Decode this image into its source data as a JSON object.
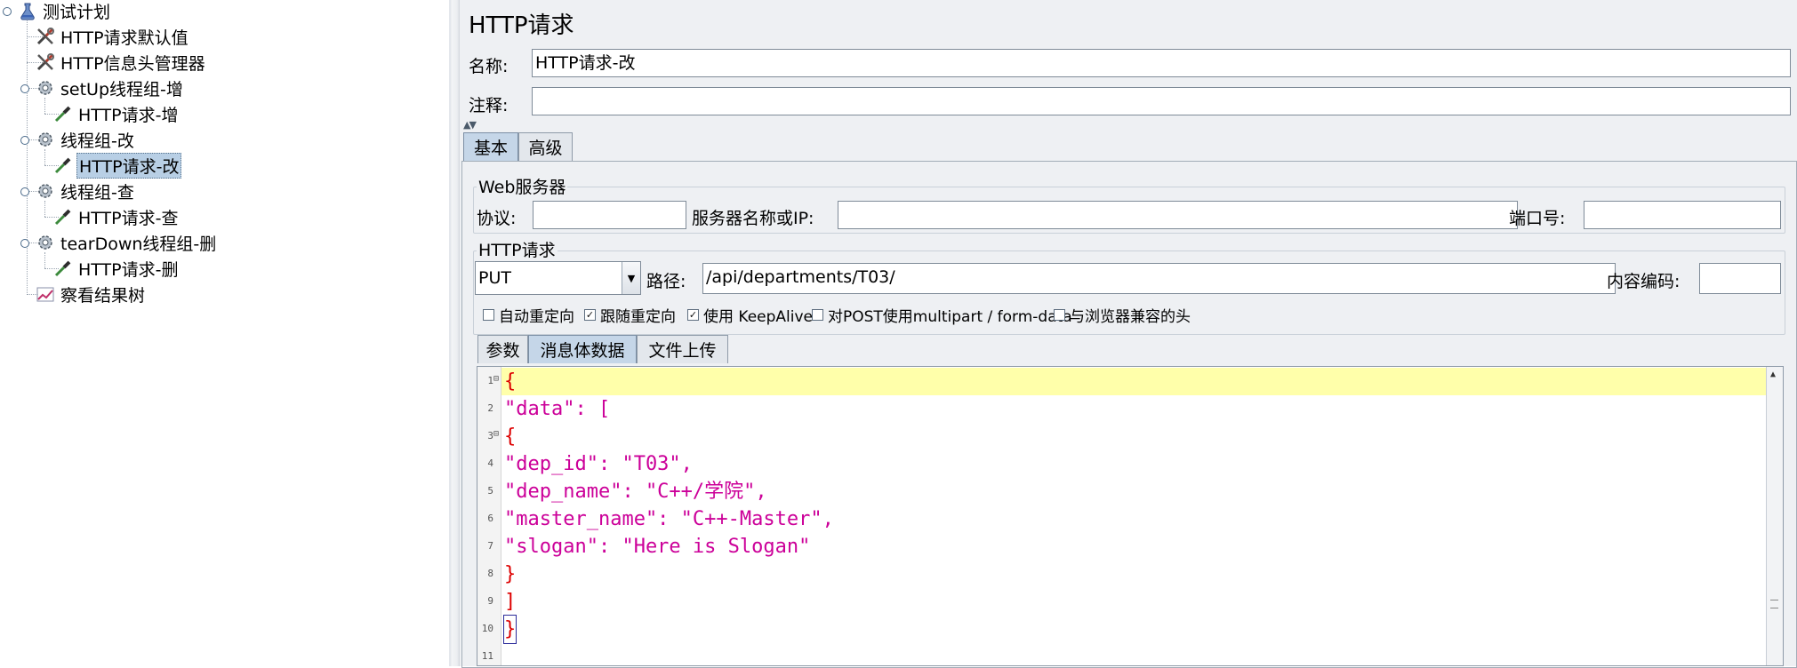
{
  "tree": {
    "items": [
      {
        "label": "测试计划",
        "icon": "flask-icon"
      },
      {
        "label": "HTTP请求默认值",
        "icon": "wrench-icon"
      },
      {
        "label": "HTTP信息头管理器",
        "icon": "wrench-icon"
      },
      {
        "label": "setUp线程组-增",
        "icon": "gear-icon"
      },
      {
        "label": "HTTP请求-增",
        "icon": "pipette-icon"
      },
      {
        "label": "线程组-改",
        "icon": "gear-icon"
      },
      {
        "label": "HTTP请求-改",
        "icon": "pipette-icon",
        "selected": true
      },
      {
        "label": "线程组-查",
        "icon": "gear-icon"
      },
      {
        "label": "HTTP请求-查",
        "icon": "pipette-icon"
      },
      {
        "label": "tearDown线程组-删",
        "icon": "gear-icon"
      },
      {
        "label": "HTTP请求-删",
        "icon": "pipette-icon"
      },
      {
        "label": "察看结果树",
        "icon": "graph-icon"
      }
    ]
  },
  "panel": {
    "title": "HTTP请求",
    "name_label": "名称:",
    "name_value": "HTTP请求-改",
    "comment_label": "注释:",
    "comment_value": "",
    "tabs": [
      "基本",
      "高级"
    ],
    "active_tab": "基本",
    "web_server": {
      "group_title": "Web服务器",
      "protocol_label": "协议:",
      "protocol_value": "",
      "server_label": "服务器名称或IP:",
      "server_value": "",
      "port_label": "端口号:",
      "port_value": ""
    },
    "http_request": {
      "group_title": "HTTP请求",
      "method": "PUT",
      "path_label": "路径:",
      "path_value": "/api/departments/T03/",
      "encoding_label": "内容编码:",
      "encoding_value": ""
    },
    "checkboxes": [
      {
        "label": "自动重定向",
        "checked": false
      },
      {
        "label": "跟随重定向",
        "checked": true
      },
      {
        "label": "使用 KeepAlive",
        "checked": true
      },
      {
        "label": "对POST使用multipart / form-data",
        "checked": false
      },
      {
        "label": "与浏览器兼容的头",
        "checked": false
      }
    ],
    "sub_tabs": [
      "参数",
      "消息体数据",
      "文件上传"
    ],
    "active_sub_tab": "消息体数据"
  },
  "editor": {
    "line_numbers": [
      "1",
      "2",
      "3",
      "4",
      "5",
      "6",
      "7",
      "8",
      "9",
      "10",
      "11"
    ],
    "lines": [
      "{",
      "\"data\": [",
      "{",
      "\"dep_id\": \"T03\",",
      "\"dep_name\": \"C++/学院\",",
      "\"master_name\": \"C++-Master\",",
      "\"slogan\": \"Here is Slogan\"",
      "}",
      "]",
      "}",
      ""
    ]
  },
  "colors": {
    "selection": "#b8cfe5",
    "highlight_line": "#ffffaa",
    "json_string": "#cc0099",
    "json_bracket": "#dd0000",
    "active_tab": "#c5d6e8"
  }
}
